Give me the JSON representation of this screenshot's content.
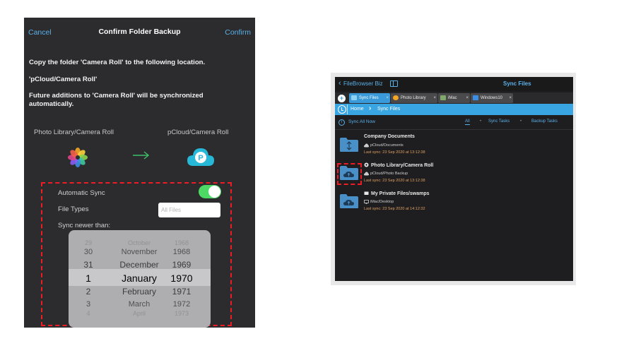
{
  "left_panel": {
    "nav": {
      "cancel": "Cancel",
      "title": "Confirm Folder Backup",
      "confirm": "Confirm"
    },
    "message": {
      "line1": "Copy the folder 'Camera Roll' to the following location.",
      "line2": "'pCloud/Camera Roll'",
      "line3": "Future additions to 'Camera Roll' will be synchronized automatically."
    },
    "source_label": "Photo Library/Camera Roll",
    "destination_label": "pCloud/Camera Roll",
    "settings": {
      "automatic_sync_label": "Automatic Sync",
      "automatic_sync_on": true,
      "file_types_label": "File Types",
      "file_types_placeholder": "All Files",
      "sync_newer_label": "Sync newer than:"
    },
    "date_picker": {
      "days": [
        "29",
        "30",
        "31",
        "1",
        "2",
        "3",
        "4"
      ],
      "months": [
        "October",
        "November",
        "December",
        "January",
        "February",
        "March",
        "April"
      ],
      "years": [
        "1968",
        "1968",
        "1969",
        "1970",
        "1971",
        "1972",
        "1973"
      ]
    },
    "accent_color": "#5ab0e8",
    "toggle_color": "#4cd964",
    "highlight_color": "#ee1c24"
  },
  "right_panel": {
    "header": {
      "back_label": "FileBrowser Biz",
      "title": "Sync Files"
    },
    "tabs": [
      {
        "label": "Sync Files",
        "active": true
      },
      {
        "label": "Photo Library",
        "active": false
      },
      {
        "label": "iMac",
        "active": false
      },
      {
        "label": "Windows10",
        "active": false
      }
    ],
    "breadcrumb": {
      "home": "Home",
      "current": "Sync Files"
    },
    "toolbar": {
      "sync_all": "Sync All Now",
      "filter_all": "All",
      "filter_sync": "Sync Tasks",
      "filter_backup": "Backup Tasks"
    },
    "rows": [
      {
        "name": "Company Documents",
        "location": "pCloud/Documents",
        "last_sync": "Last sync: 23 Sep 2020 at 13:12:38",
        "icon": "folder-sync-icon"
      },
      {
        "name": "Photo Library/Camera Roll",
        "location": "pCloud/Photo Backup",
        "last_sync": "Last sync: 23 Sep 2020 at 13:12:38",
        "icon": "folder-cloud-icon"
      },
      {
        "name": "My Private Files/swamps",
        "location": "iMac/Desktop",
        "last_sync": "Last sync: 23 Sep 2020 at 14:12:32",
        "icon": "folder-cloud-icon"
      }
    ],
    "accent_color": "#3aa5e3"
  }
}
